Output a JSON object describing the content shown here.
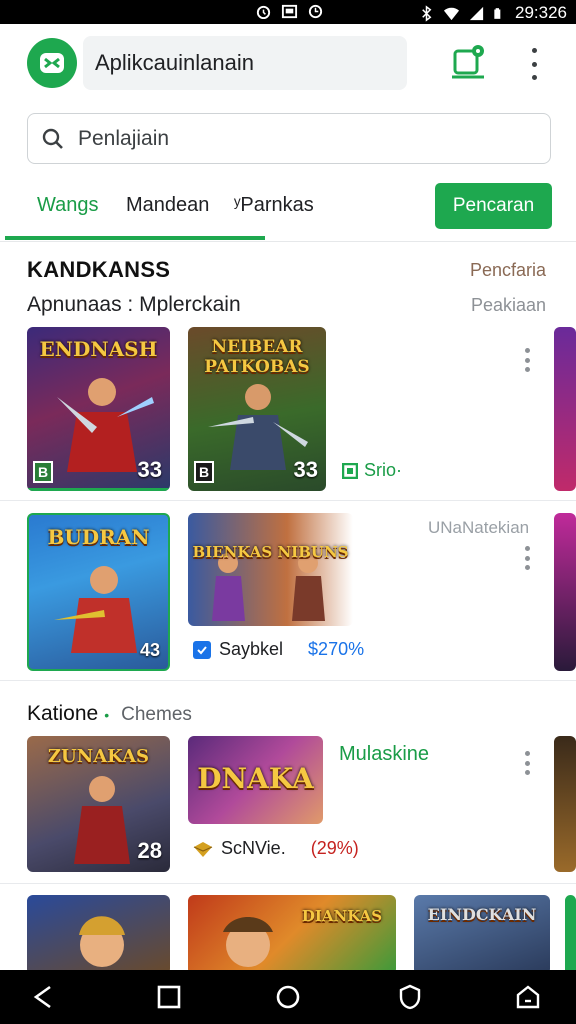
{
  "status_bar": {
    "time": "29:326",
    "icons": [
      "alarm-icon",
      "cast-icon",
      "sync-icon",
      "bluetooth-icon",
      "wifi-icon",
      "signal-icon",
      "battery-icon"
    ]
  },
  "header": {
    "title": "Aplikcauinlanain",
    "logo_icon": "app-logo-icon",
    "cart_icon": "cart-icon",
    "more_icon": "more-vert-icon"
  },
  "search": {
    "placeholder": "Penlajiain",
    "value": ""
  },
  "tabs": {
    "items": [
      {
        "label": "Wangs",
        "active": true
      },
      {
        "label": "Mandean",
        "active": false
      },
      {
        "label": "ʸParnkas",
        "active": false
      }
    ],
    "cta_label": "Pencaran"
  },
  "section1": {
    "title": "KANDKANSS",
    "subtitle": "Apnunaas : Mplerckain",
    "link1": "Pencfaria",
    "link2": "Peakiaan"
  },
  "row1": {
    "cards": [
      {
        "title": "ENDNASH",
        "badge": "33",
        "age": "B"
      },
      {
        "title": "NEIBEAR PATKOBAS",
        "badge": "33",
        "age": "B"
      }
    ],
    "meta_label": "Srio·",
    "meta_icon": "badge-icon"
  },
  "row2": {
    "cards": [
      {
        "title": "BUDRAN",
        "badge": "43"
      },
      {
        "title": "BIENKAS NIBUNS"
      }
    ],
    "right_label": "UNaNatekian",
    "meta_label": "Saybkel",
    "meta_value": "$270%",
    "meta_icon": "shield-icon"
  },
  "section2": {
    "title": "Katione",
    "separator": "•",
    "subtitle": "Chemes"
  },
  "row3": {
    "cards": [
      {
        "title": "ZUNAKAS",
        "badge": "28"
      },
      {
        "title": "DNAKA"
      }
    ],
    "right_label": "Mulaskine",
    "meta_label": "ScNVie.",
    "meta_value": "(29%)",
    "meta_icon": "gold-icon"
  },
  "row4": {
    "cards": [
      {
        "title": ""
      },
      {
        "title": "DIANKAS"
      },
      {
        "title": "EINDCKAIN"
      }
    ]
  },
  "nav_bar": {
    "icons": [
      "back-icon",
      "recents-icon",
      "home-icon",
      "shield-nav-icon",
      "share-icon"
    ]
  },
  "colors": {
    "accent": "#1ea84f",
    "accent_text": "#1a9c47",
    "link_brown": "#8a6a55"
  }
}
